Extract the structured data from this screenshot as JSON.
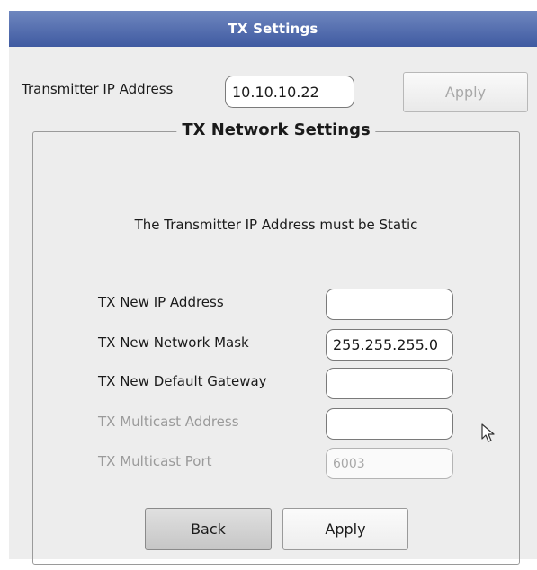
{
  "window": {
    "title": "TX Settings"
  },
  "transmitter": {
    "ip_label": "Transmitter IP Address",
    "ip_value": "10.10.10.22",
    "apply_label": "Apply"
  },
  "network": {
    "group_title": "TX Network Settings",
    "static_message": "The Transmitter IP Address must be Static",
    "fields": [
      {
        "label": "TX New IP Address",
        "value": "",
        "enabled": true
      },
      {
        "label": "TX New Network Mask",
        "value": "255.255.255.0",
        "enabled": true
      },
      {
        "label": "TX New Default Gateway",
        "value": "",
        "enabled": true
      },
      {
        "label": "TX Multicast Address",
        "value": "",
        "enabled": false
      },
      {
        "label": "TX Multicast Port",
        "value": "6003",
        "enabled": false
      }
    ],
    "back_label": "Back",
    "apply_label": "Apply"
  },
  "icons": {
    "cursor": "mouse-pointer-icon"
  },
  "colors": {
    "titlebar": "#4c66a9",
    "panel_background": "#ededed",
    "disabled_text": "#9a9a9a"
  }
}
